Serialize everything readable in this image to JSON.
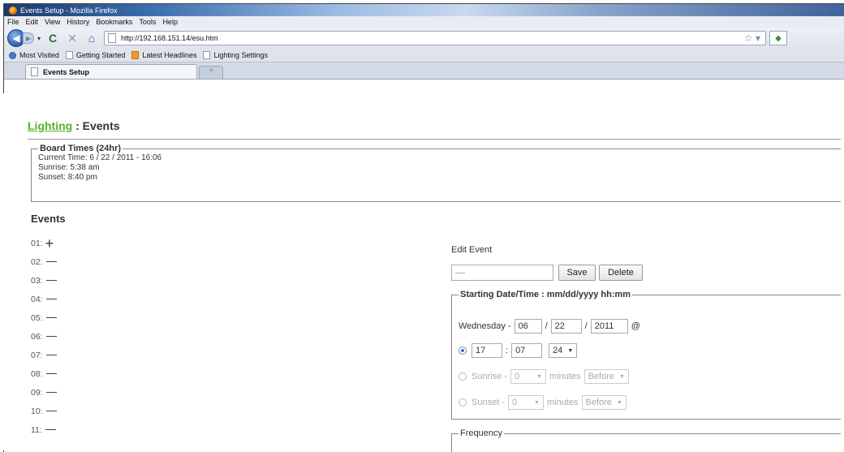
{
  "window": {
    "title": "Events Setup - Mozilla Firefox"
  },
  "menu": [
    "File",
    "Edit",
    "View",
    "History",
    "Bookmarks",
    "Tools",
    "Help"
  ],
  "url": "http://192.168.151.14/esu.htm",
  "bookmarks": [
    "Most Visited",
    "Getting Started",
    "Latest Headlines",
    "Lighting Settings"
  ],
  "tab": {
    "title": "Events Setup",
    "new_tab": "+"
  },
  "page": {
    "crumb_link": "Lighting",
    "crumb_rest": " : Events",
    "board": {
      "legend": "Board Times (24hr)",
      "current_time": "Current Time: 6 / 22 / 2011 - 16:06",
      "sunrise": "Sunrise: 5:38 am",
      "sunset": "Sunset: 8:40 pm"
    },
    "events_title": "Events",
    "events": [
      "01:",
      "02:",
      "03:",
      "04:",
      "05:",
      "06:",
      "07:",
      "08:",
      "09:",
      "10:",
      "11:"
    ],
    "edit": {
      "title": "Edit Event",
      "name_value": "----",
      "save": "Save",
      "delete": "Delete"
    },
    "starting": {
      "legend": "Starting Date/Time : mm/dd/yyyy hh:mm",
      "weekday": "Wednesday -",
      "month": "06",
      "sep1": "/",
      "day": "22",
      "sep2": "/",
      "year": "2011",
      "at": "@",
      "hour": "17",
      "colon": ":",
      "minute": "07",
      "clock": "24",
      "sunrise_label": "Sunrise -",
      "sunrise_offset": "0",
      "minutes_label": "minutes",
      "before": "Before",
      "sunset_label": "Sunset -",
      "sunset_offset": "0"
    },
    "frequency_legend": "Frequency"
  }
}
